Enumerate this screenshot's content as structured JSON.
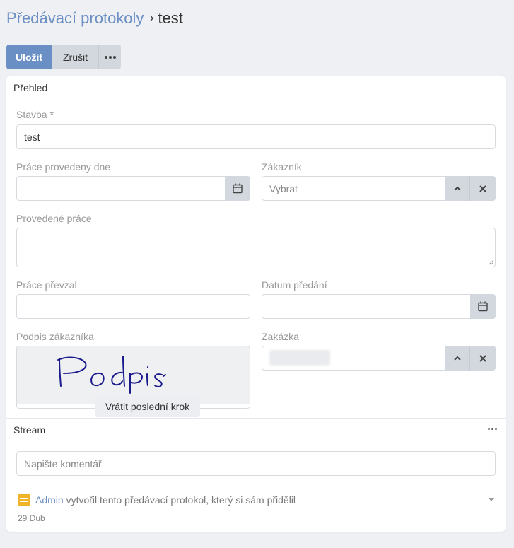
{
  "breadcrumb": {
    "parent": "Předávací protokoly",
    "separator": "›",
    "current": "test"
  },
  "toolbar": {
    "save_label": "Uložit",
    "cancel_label": "Zrušit",
    "more_icon": "ellipsis-icon"
  },
  "overview": {
    "title": "Přehled",
    "fields": {
      "stavba": {
        "label": "Stavba *",
        "value": "test"
      },
      "prace_provedeny_dne": {
        "label": "Práce provedeny dne",
        "value": "",
        "icon": "calendar-icon"
      },
      "zakaznik": {
        "label": "Zákazník",
        "placeholder": "Vybrat",
        "icons": [
          "chevron-up-icon",
          "close-icon"
        ]
      },
      "provedene_prace": {
        "label": "Provedené práce",
        "value": ""
      },
      "prace_prevzal": {
        "label": "Práce převzal",
        "value": ""
      },
      "datum_predani": {
        "label": "Datum předání",
        "value": "",
        "icon": "calendar-icon"
      },
      "podpis_zakaznika": {
        "label": "Podpis zákazníka",
        "signature_text": "Podpis",
        "undo_label": "Vrátit poslední krok"
      },
      "zakazka": {
        "label": "Zakázka",
        "value_hidden": true,
        "icons": [
          "chevron-up-icon",
          "close-icon"
        ]
      }
    }
  },
  "stream": {
    "title": "Stream",
    "comment_placeholder": "Napište komentář",
    "activity": [
      {
        "user": "Admin",
        "text": " vytvořil tento předávací protokol, který si sám přidělil",
        "date": "29 Dub"
      }
    ]
  },
  "colors": {
    "accent": "#6a8fc5",
    "link": "#6b8fc4",
    "activity_icon": "#f0b429",
    "signature_ink": "#1a1a8c"
  }
}
